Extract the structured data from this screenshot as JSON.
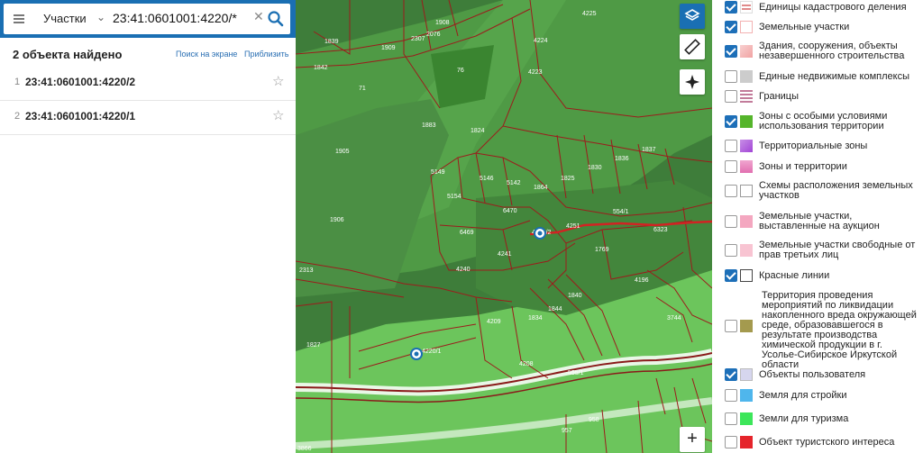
{
  "search": {
    "category": "Участки",
    "query": "23:41:0601001:4220/*"
  },
  "results": {
    "heading": "2 объекта найдено",
    "link_on_screen": "Поиск на экране",
    "link_zoom": "Приблизить",
    "items": [
      {
        "num": "1",
        "id": "23:41:0601001:4220/2"
      },
      {
        "num": "2",
        "id": "23:41:0601001:4220/1"
      }
    ]
  },
  "map": {
    "parcel_labels": [
      "4225",
      "1908",
      "1839",
      "1909",
      "2307",
      "2076",
      "1842",
      "76",
      "4224",
      "4223",
      "71",
      "1883",
      "1824",
      "1905",
      "5149",
      "5146",
      "5142",
      "1864",
      "1825",
      "1830",
      "1836",
      "1837",
      "5154",
      "6470",
      "6469",
      "4251",
      "554/1",
      "6323",
      "1906",
      "4241",
      "1769",
      "2313",
      "4240",
      "4196",
      "1840",
      "1844",
      "1834",
      "4209",
      "3744",
      "1827",
      "4208",
      "555/1",
      "957",
      "958",
      "3866",
      "4220/2",
      "4220/1"
    ],
    "zoom_in": "+"
  },
  "legend": {
    "items": [
      {
        "label": "Единицы кадастрового деления",
        "checked": true,
        "color": "#e08a8a"
      },
      {
        "label": "Земельные участки",
        "checked": true,
        "color": "#f3b2b2"
      },
      {
        "label": "Здания, сооружения, объекты незавершенного строительства",
        "checked": true,
        "color": "#f1a3a3"
      },
      {
        "label": "Единые недвижимые комплексы",
        "checked": false,
        "color": "#cccccc"
      },
      {
        "label": "Границы",
        "checked": false,
        "color": "#c27b9a"
      },
      {
        "label": "Зоны с особыми условиями использования территории",
        "checked": true,
        "color": "#55b52b"
      },
      {
        "label": "Территориальные зоны",
        "checked": false,
        "color": "#a246d6"
      },
      {
        "label": "Зоны и территории",
        "checked": false,
        "color": "#e26fb0"
      },
      {
        "label": "Схемы расположения земельных участков",
        "checked": false,
        "color": "#ffffff"
      },
      {
        "label": "Земельные участки, выставленные на аукцион",
        "checked": false,
        "color": "#f4a7c0"
      },
      {
        "label": "Земельные участки свободные от прав третьих лиц",
        "checked": false,
        "color": "#f8c4d2"
      },
      {
        "label": "Красные линии",
        "checked": true,
        "color": "#ffffff"
      },
      {
        "label": "Территория проведения мероприятий по ликвидации накопленного вреда окружающей среде, образовавшегося в результате производства химической продукции в г. Усолье-Сибирское Иркутской области",
        "checked": false,
        "color": "#a49a4e"
      },
      {
        "label": "Объекты пользователя",
        "checked": true,
        "color": "#d6d6ee"
      },
      {
        "label": "Земля для стройки",
        "checked": false,
        "color": "#4fb6ec"
      },
      {
        "label": "Земли для туризма",
        "checked": false,
        "color": "#3ce65a"
      },
      {
        "label": "Объект туристского интереса",
        "checked": false,
        "color": "#e5242b"
      }
    ]
  }
}
